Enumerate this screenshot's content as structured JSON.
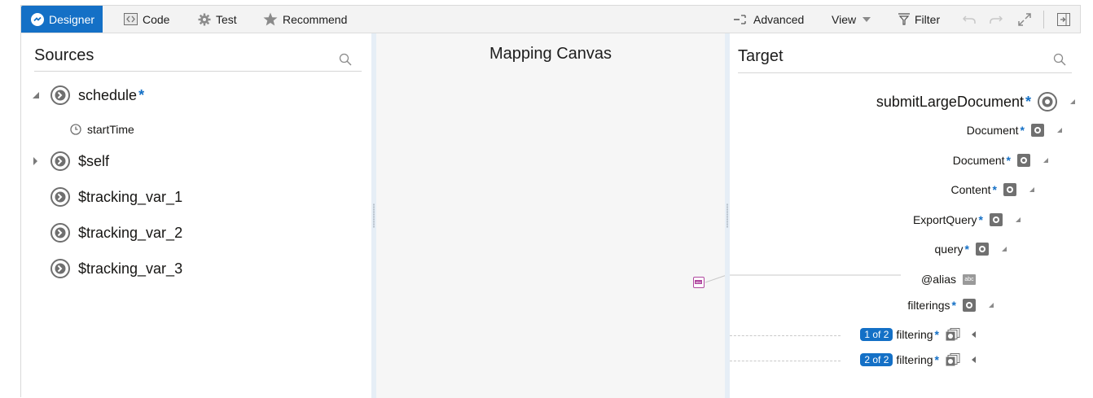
{
  "toolbar": {
    "designer": "Designer",
    "code": "Code",
    "test": "Test",
    "recommend": "Recommend",
    "advanced": "Advanced",
    "view": "View",
    "filter": "Filter"
  },
  "sources": {
    "title": "Sources",
    "items": [
      {
        "label": "schedule",
        "required": "*"
      },
      {
        "label": "startTime"
      },
      {
        "label": "$self"
      },
      {
        "label": "$tracking_var_1"
      },
      {
        "label": "$tracking_var_2"
      },
      {
        "label": "$tracking_var_3"
      }
    ]
  },
  "canvas": {
    "title": "Mapping Canvas",
    "function_icon": "abc"
  },
  "target": {
    "title": "Target",
    "root": {
      "label": "submitLargeDocument",
      "required": "*"
    },
    "rows": [
      {
        "label": "Document",
        "required": "*"
      },
      {
        "label": "Document",
        "required": "*"
      },
      {
        "label": "Content",
        "required": "*"
      },
      {
        "label": "ExportQuery",
        "required": "*"
      },
      {
        "label": "query",
        "required": "*"
      },
      {
        "label": "@alias",
        "type_icon": "abc"
      },
      {
        "label": "filterings",
        "required": "*"
      },
      {
        "badge": "1 of 2",
        "label": "filtering",
        "required": "*"
      },
      {
        "badge": "2 of 2",
        "label": "filtering",
        "required": "*"
      }
    ]
  },
  "colors": {
    "accent": "#1470c6",
    "canvas_bg": "#f6f6f6",
    "function_icon": "#b0479f"
  }
}
